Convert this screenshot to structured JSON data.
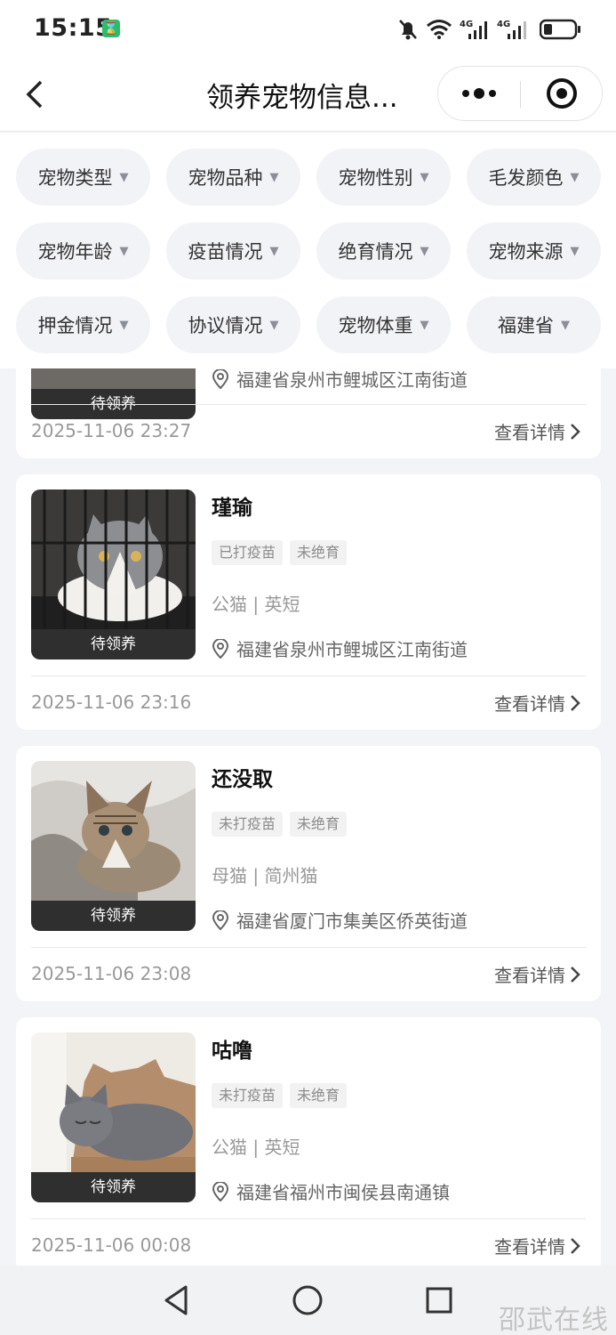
{
  "status_bar": {
    "time": "15:15",
    "net1": "4G",
    "net2": "4G"
  },
  "nav": {
    "title": "领养宠物信息..."
  },
  "filters": [
    "宠物类型",
    "宠物品种",
    "宠物性别",
    "毛发颜色",
    "宠物年龄",
    "疫苗情况",
    "绝育情况",
    "宠物来源",
    "押金情况",
    "协议情况",
    "宠物体重",
    "福建省"
  ],
  "pets": [
    {
      "status": "待领养",
      "location": "福建省泉州市鲤城区江南街道",
      "date": "2025-11-06 23:27",
      "detail_label": "查看详情"
    },
    {
      "name": "瑾瑜",
      "tags": [
        "已打疫苗",
        "未绝育"
      ],
      "info": "公猫 | 英短",
      "status": "待领养",
      "location": "福建省泉州市鲤城区江南街道",
      "date": "2025-11-06 23:16",
      "detail_label": "查看详情"
    },
    {
      "name": "还没取",
      "tags": [
        "未打疫苗",
        "未绝育"
      ],
      "info": "母猫 | 简州猫",
      "status": "待领养",
      "location": "福建省厦门市集美区侨英街道",
      "date": "2025-11-06 23:08",
      "detail_label": "查看详情"
    },
    {
      "name": "咕噜",
      "tags": [
        "未打疫苗",
        "未绝育"
      ],
      "info": "公猫 | 英短",
      "status": "待领养",
      "location": "福建省福州市闽侯县南通镇",
      "date": "2025-11-06 00:08",
      "detail_label": "查看详情"
    }
  ],
  "watermark": "邵武在线"
}
